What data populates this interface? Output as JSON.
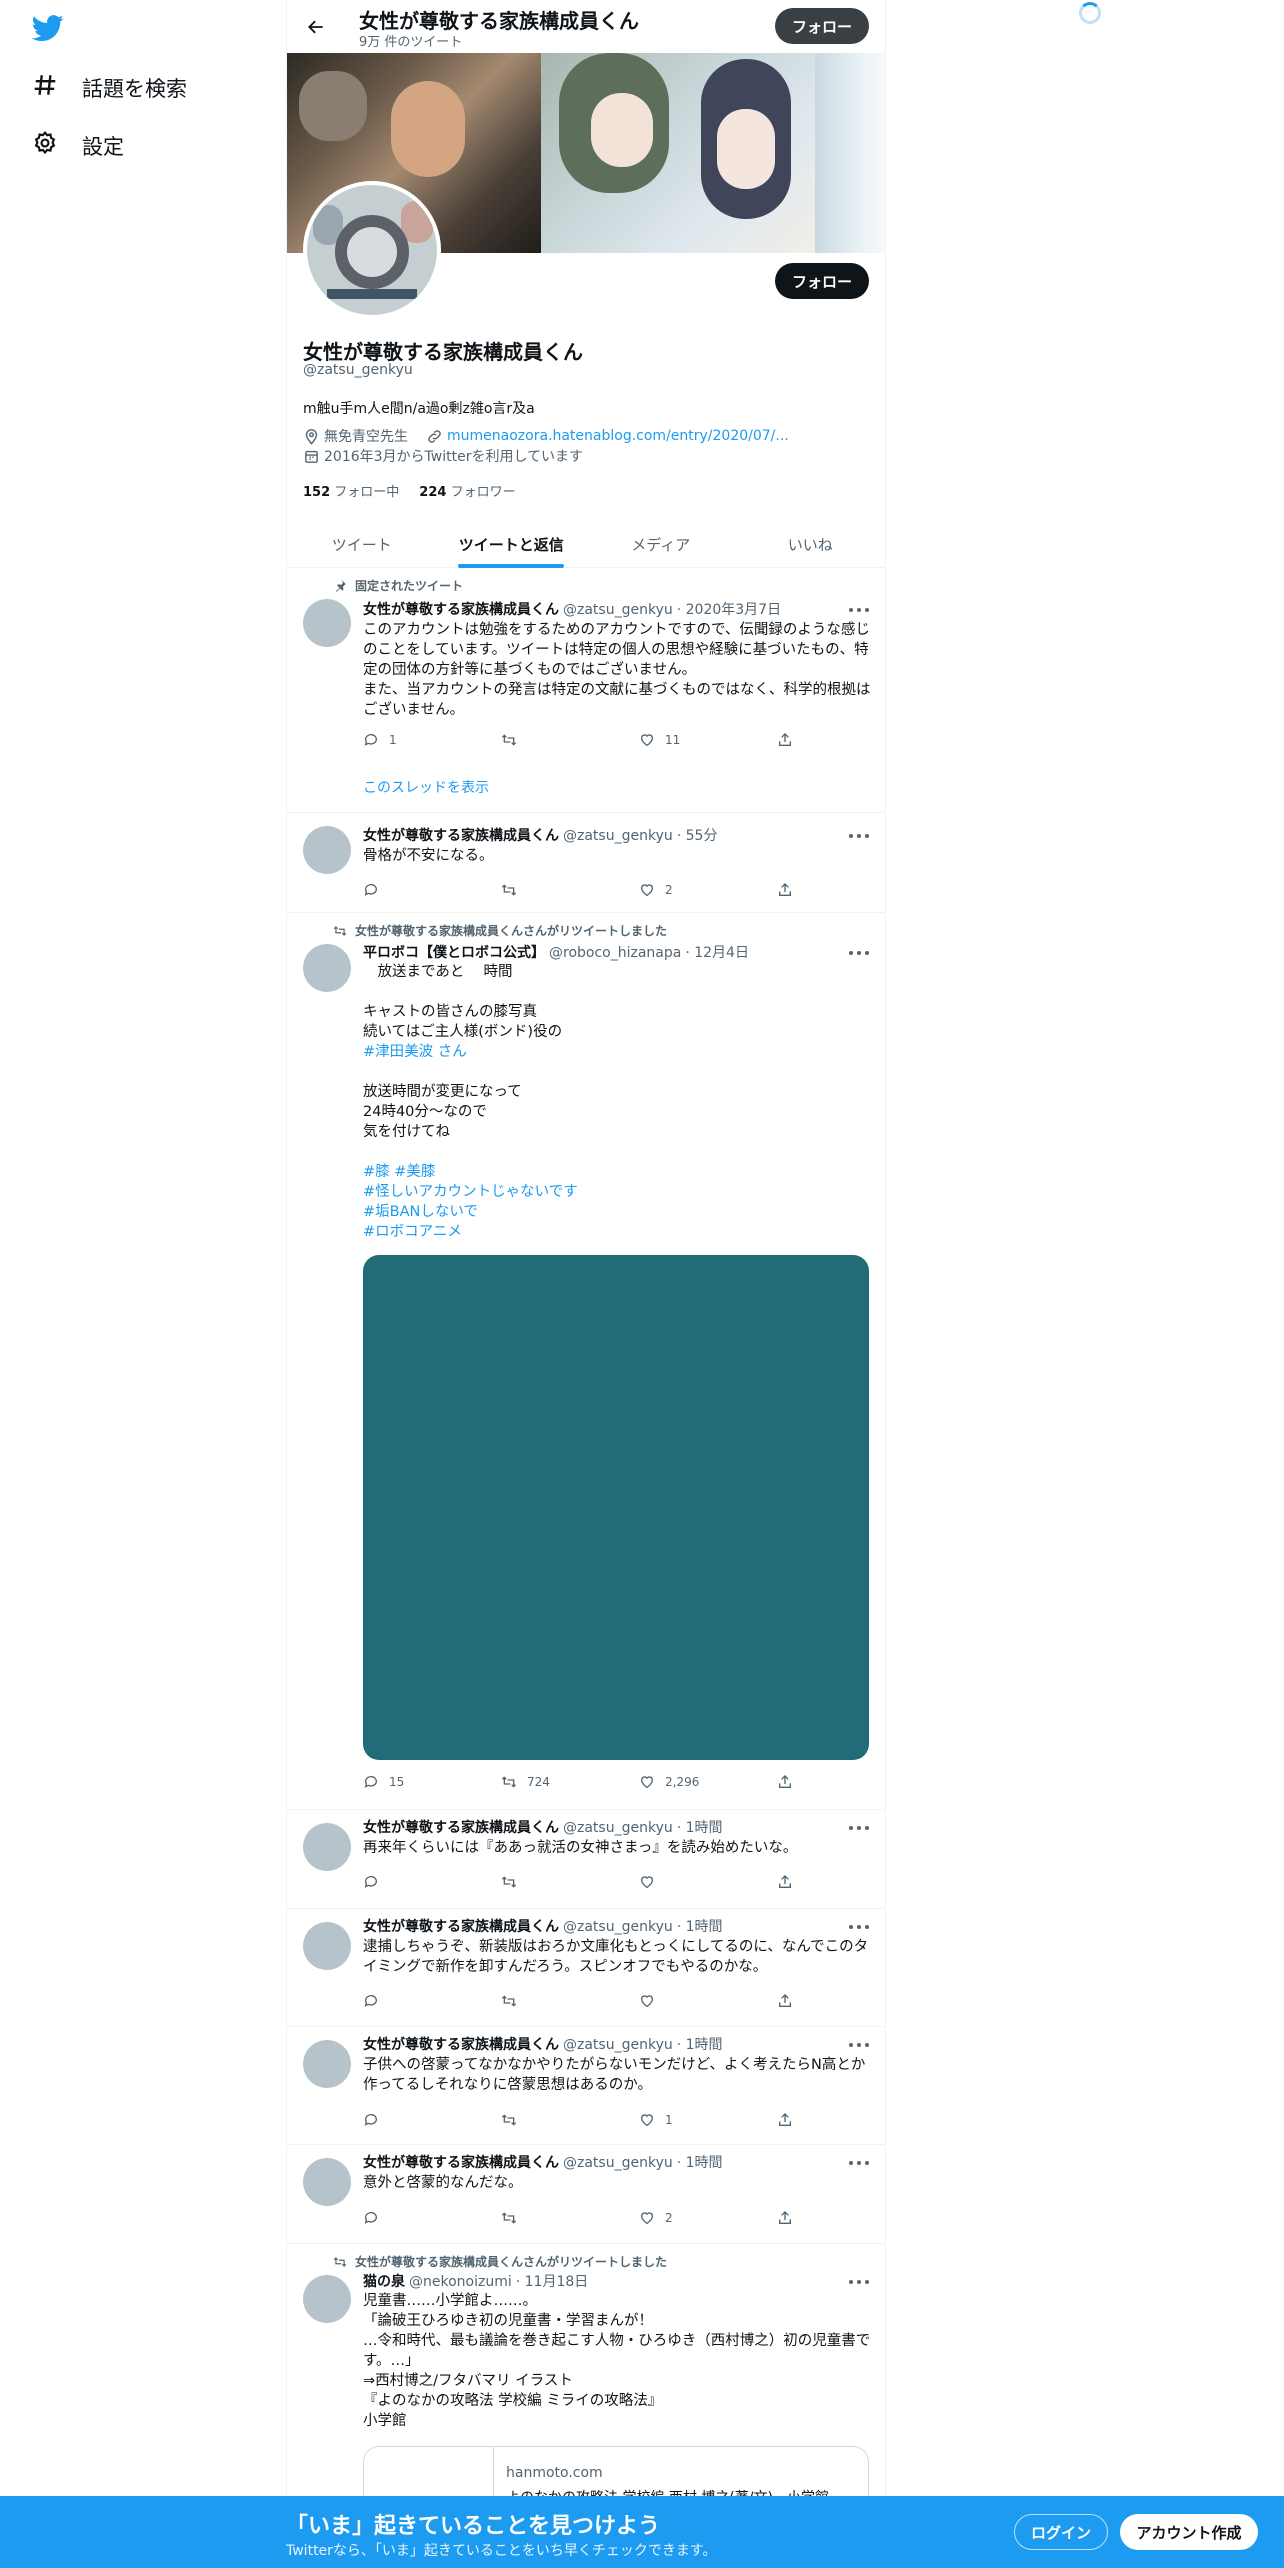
{
  "nav": {
    "explore_label": "話題を検索",
    "settings_label": "設定"
  },
  "header": {
    "title": "女性が尊敬する家族構成員くん",
    "tweet_count": "9万 件のツイート",
    "follow_label": "フォロー"
  },
  "profile": {
    "name": "女性が尊敬する家族構成員くん",
    "handle": "@zatsu_genkyu",
    "bio": "m触u手m人e間n/a過o剰z雑o言r及a",
    "location": "無免青空先生",
    "url": "mumenaozora.hatenablog.com/entry/2020/07/...",
    "joined": "2016年3月からTwitterを利用しています",
    "following_count": "152",
    "following_label": "フォロー中",
    "followers_count": "224",
    "followers_label": "フォロワー",
    "follow_label": "フォロー"
  },
  "tabs": [
    "ツイート",
    "ツイートと返信",
    "メディア",
    "いいね"
  ],
  "tweets": [
    {
      "social": "固定されたツイート",
      "name": "女性が尊敬する家族構成員くん",
      "handle": "@zatsu_genkyu",
      "date": "· 2020年3月7日",
      "text": "このアカウントは勉強をするためのアカウントですので、伝聞録のような感じのことをしています。ツイートは特定の個人の思想や経験に基づいたもの、特定の団体の方針等に基づくものではございません。\nまた、当アカウントの発言は特定の文献に基づくものではなく、科学的根拠はございません。",
      "replies": "1",
      "retweets": "",
      "likes": "11",
      "thread_label": "このスレッドを表示"
    },
    {
      "name": "女性が尊敬する家族構成員くん",
      "handle": "@zatsu_genkyu",
      "date": "· 55分",
      "text": "骨格が不安になる。",
      "replies": "",
      "retweets": "",
      "likes": "2"
    },
    {
      "social": "女性が尊敬する家族構成員くんさんがリツイートしました",
      "name": "平ロボコ【僕とロボコ公式】",
      "handle": "@roboco_hizanapa",
      "date": "· 12月4日",
      "text_lines": [
        "　放送まであと　 時間",
        "",
        "キャストの皆さんの膝写真",
        "続いてはご主人様(ボンド)役の",
        "#津田美波 さん",
        "",
        "放送時間が変更になって",
        "24時40分～なので",
        "気を付けてね",
        "",
        "#膝 #美膝",
        "#怪しいアカウントじゃないです",
        "#垢BANしないで",
        "#ロボコアニメ"
      ],
      "replies": "15",
      "retweets": "724",
      "likes": "2,296"
    },
    {
      "name": "女性が尊敬する家族構成員くん",
      "handle": "@zatsu_genkyu",
      "date": "· 1時間",
      "text": "再来年くらいには『ああっ就活の女神さまっ』を読み始めたいな。",
      "replies": "",
      "retweets": "",
      "likes": ""
    },
    {
      "name": "女性が尊敬する家族構成員くん",
      "handle": "@zatsu_genkyu",
      "date": "· 1時間",
      "text": "逮捕しちゃうぞ、新装版はおろか文庫化もとっくにしてるのに、なんでこのタイミングで新作を卸すんだろう。スピンオフでもやるのかな。",
      "replies": "",
      "retweets": "",
      "likes": ""
    },
    {
      "name": "女性が尊敬する家族構成員くん",
      "handle": "@zatsu_genkyu",
      "date": "· 1時間",
      "text": "子供への啓蒙ってなかなかやりたがらないモンだけど、よく考えたらN高とか作ってるしそれなりに啓蒙思想はあるのか。",
      "replies": "",
      "retweets": "",
      "likes": "1"
    },
    {
      "name": "女性が尊敬する家族構成員くん",
      "handle": "@zatsu_genkyu",
      "date": "· 1時間",
      "text": "意外と啓蒙的なんだな。",
      "replies": "",
      "retweets": "",
      "likes": "2"
    },
    {
      "social": "女性が尊敬する家族構成員くんさんがリツイートしました",
      "name": "猫の泉",
      "handle": "@nekonoizumi",
      "date": "· 11月18日",
      "text": "児童書……小学館よ……。\n「論破王ひろゆき初の児童書・学習まんが！\n…令和時代、最も議論を巻き起こす人物・ひろゆき（西村博之）初の児童書です。…」\n⇒西村博之/フタバマリ イラスト\n『よのなかの攻略法 学校編 ミライの攻略法』\n小学館",
      "link_domain": "hanmoto.com",
      "link_title": "よのなかの攻略法 学校編 西村 博之(著/文) - 小学館"
    }
  ],
  "bottom_bar": {
    "title": "「いま」起きていることを見つけよう",
    "subtitle": "Twitterなら、「いま」起きていることをいち早くチェックできます。",
    "login_label": "ログイン",
    "signup_label": "アカウント作成"
  },
  "colors": {
    "accent": "#1d9bf0",
    "text": "#0f1419",
    "secondary": "#536471",
    "media_bg": "#226b79"
  }
}
